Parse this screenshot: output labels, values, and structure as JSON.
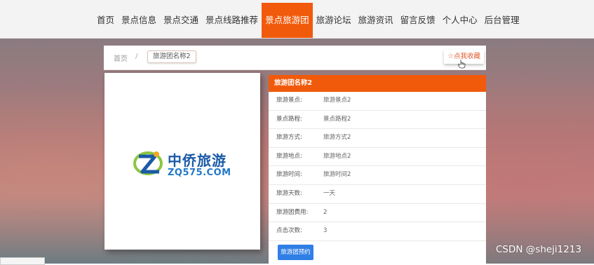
{
  "nav": {
    "items": [
      {
        "label": "首页"
      },
      {
        "label": "景点信息"
      },
      {
        "label": "景点交通"
      },
      {
        "label": "景点线路推荐"
      },
      {
        "label": "景点旅游团"
      },
      {
        "label": "旅游论坛"
      },
      {
        "label": "旅游资讯"
      },
      {
        "label": "留言反馈"
      },
      {
        "label": "个人中心"
      },
      {
        "label": "后台管理"
      }
    ],
    "active_index": 4,
    "active_color": "#f15a0b"
  },
  "breadcrumb": {
    "home": "首页",
    "separator": "/",
    "current": "旅游团名称2"
  },
  "favorite": {
    "icon": "star-outline-icon",
    "label": "☆点我收藏"
  },
  "image": {
    "logo_cn": "中侨旅游",
    "logo_en": "ZQ575.COM"
  },
  "detail": {
    "title": "旅游团名称2",
    "rows": [
      {
        "key": "旅游景点:",
        "value": "旅游景点2"
      },
      {
        "key": "景点路程:",
        "value": "景点路程2"
      },
      {
        "key": "旅游方式:",
        "value": "旅游方式2"
      },
      {
        "key": "旅游地点:",
        "value": "旅游地点2"
      },
      {
        "key": "旅游时间:",
        "value": "旅游时间2"
      },
      {
        "key": "旅游天数:",
        "value": "一天"
      },
      {
        "key": "旅游团费用:",
        "value": "2"
      },
      {
        "key": "点击次数:",
        "value": "3"
      }
    ],
    "book_button": "旅游团预约",
    "book_color": "#2f7fe6"
  },
  "watermark": "CSDN @sheji1213"
}
